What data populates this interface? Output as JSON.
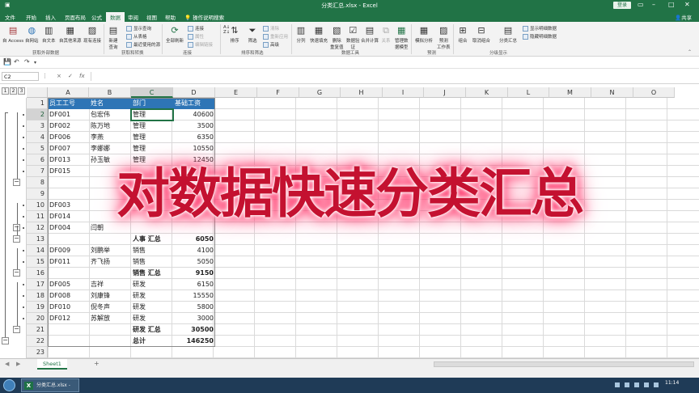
{
  "window": {
    "title": "分类汇总.xlsx - Excel",
    "sign_in": "登录",
    "share": "共享"
  },
  "menu_tabs": [
    "文件",
    "开始",
    "插入",
    "页面布局",
    "公式",
    "数据",
    "审阅",
    "视图",
    "帮助"
  ],
  "active_tab": "数据",
  "tell_me": "操作说明搜索",
  "ribbon": {
    "external_data": {
      "group": "获取外部数据",
      "items": [
        "自 Access",
        "自网站",
        "自文本",
        "自其他来源",
        "现有连接"
      ]
    },
    "get_transform": {
      "group": "获取和转换",
      "new_query": "新建\n查询",
      "small": [
        "显示查询",
        "从表格",
        "最近使用的源"
      ]
    },
    "connections": {
      "group": "连接",
      "refresh_all": "全部刷新",
      "small": [
        "连接",
        "属性",
        "编辑链接"
      ]
    },
    "sort_filter": {
      "group": "排序和筛选",
      "sort": "排序",
      "filter": "筛选",
      "small": [
        "清除",
        "重新应用",
        "高级"
      ]
    },
    "data_tools": {
      "group": "数据工具",
      "items": [
        "分列",
        "快速填充",
        "删除\n重复值",
        "数据验\n证",
        "合并计算",
        "关系",
        "管理数\n据模型"
      ]
    },
    "forecast": {
      "group": "预测",
      "items": [
        "模拟分析",
        "预测\n工作表"
      ]
    },
    "outline": {
      "group": "分级显示",
      "items": [
        "组合",
        "取消组合",
        "分类汇总"
      ],
      "small": [
        "显示明细数据",
        "隐藏明细数据"
      ]
    }
  },
  "formula_bar": {
    "name_box": "C2",
    "cancel": "×",
    "enter": "✓",
    "fx": "fx",
    "content": ""
  },
  "outline_levels": [
    "1",
    "2",
    "3"
  ],
  "columns": [
    "A",
    "B",
    "C",
    "D",
    "E",
    "F",
    "G",
    "H",
    "I",
    "J",
    "K",
    "L",
    "M",
    "N",
    "O"
  ],
  "selected_column": "C",
  "selected_row": 2,
  "rows": [
    "1",
    "2",
    "3",
    "4",
    "5",
    "6",
    "7",
    "8",
    "9",
    "10",
    "11",
    "12",
    "13",
    "14",
    "15",
    "16",
    "17",
    "18",
    "19",
    "20",
    "21",
    "22",
    "23"
  ],
  "headers": [
    "员工工号",
    "姓名",
    "部门",
    "基础工资"
  ],
  "cells": [
    {
      "r": 2,
      "a": "DF001",
      "b": "包宏伟",
      "c": "管理",
      "d": "40600"
    },
    {
      "r": 3,
      "a": "DF002",
      "b": "陈万地",
      "c": "管理",
      "d": "3500"
    },
    {
      "r": 4,
      "a": "DF006",
      "b": "李燕",
      "c": "管理",
      "d": "6350"
    },
    {
      "r": 5,
      "a": "DF007",
      "b": "李娜娜",
      "c": "管理",
      "d": "10550"
    },
    {
      "r": 6,
      "a": "DF013",
      "b": "孙玉敏",
      "c": "管理",
      "d": "12450"
    },
    {
      "r": 7,
      "a": "DF015",
      "b": "",
      "c": "",
      "d": ""
    },
    {
      "r": 10,
      "a": "DF003",
      "b": "",
      "c": "",
      "d": ""
    },
    {
      "r": 11,
      "a": "DF014",
      "b": "",
      "c": "",
      "d": ""
    },
    {
      "r": 12,
      "a": "DF004",
      "b": "闫朝",
      "c": "",
      "d": ""
    },
    {
      "r": 13,
      "a": "",
      "b": "",
      "c": "人事 汇总",
      "d": "6050",
      "bold": true
    },
    {
      "r": 14,
      "a": "DF009",
      "b": "刘鹏举",
      "c": "销售",
      "d": "4100"
    },
    {
      "r": 15,
      "a": "DF011",
      "b": "齐飞扬",
      "c": "销售",
      "d": "5050"
    },
    {
      "r": 16,
      "a": "",
      "b": "",
      "c": "销售 汇总",
      "d": "9150",
      "bold": true
    },
    {
      "r": 17,
      "a": "DF005",
      "b": "吉祥",
      "c": "研发",
      "d": "6150"
    },
    {
      "r": 18,
      "a": "DF008",
      "b": "刘康锋",
      "c": "研发",
      "d": "15550"
    },
    {
      "r": 19,
      "a": "DF010",
      "b": "倪冬声",
      "c": "研发",
      "d": "5800"
    },
    {
      "r": 20,
      "a": "DF012",
      "b": "苏解放",
      "c": "研发",
      "d": "3000"
    },
    {
      "r": 21,
      "a": "",
      "b": "",
      "c": "研发 汇总",
      "d": "30500",
      "bold": true
    },
    {
      "r": 22,
      "a": "",
      "b": "",
      "c": "总计",
      "d": "146250",
      "bold": true
    }
  ],
  "sheet_tab": "Sheet1",
  "add_sheet": "+",
  "overlay_title": "对数据快速分类汇总",
  "taskbar": {
    "app_label": "分类汇总.xlsx - E...",
    "time": "11:14"
  },
  "colors": {
    "excel_green": "#217346",
    "header_fill": "#2e75b6",
    "overlay_text": "#c41130",
    "overlay_glow": "#ff2a62"
  }
}
